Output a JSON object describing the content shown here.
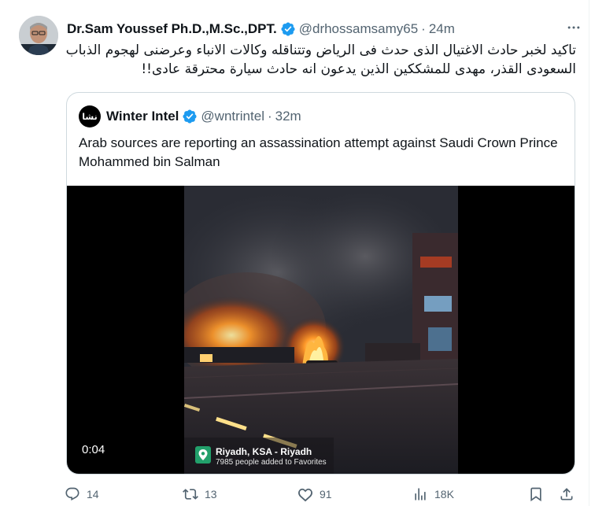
{
  "tweet": {
    "author_name": "Dr.Sam Youssef Ph.D.,M.Sc.,DPT.",
    "handle": "@drhossamsamy65",
    "separator": "·",
    "time": "24m",
    "text": "تاكيد لخبر حادث الاغتيال الذى حدث فى الرياض وتتناقله وكالات الانباء وعرضنى لهجوم الذباب السعودى القذر، مهدى للمشككين الذين يدعون انه حادث سيارة محترقة عادى!!"
  },
  "quote": {
    "avatar_text": "نشا",
    "author_name": "Winter Intel",
    "handle": "@wntrintel",
    "separator": "·",
    "time": "32m",
    "text": "Arab sources are reporting an assassination attempt against Saudi Crown Prince Mohammed bin Salman",
    "video": {
      "duration": "0:04",
      "location_title": "Riyadh, KSA - Riyadh",
      "location_subtitle": "7985 people added to Favorites"
    }
  },
  "actions": {
    "reply_count": "14",
    "retweet_count": "13",
    "like_count": "91",
    "views_count": "18K"
  },
  "colors": {
    "verified": "#1d9bf0",
    "muted": "#536471",
    "text": "#0f1419",
    "border": "#cfd9de"
  },
  "icons": [
    "verified-badge-icon",
    "more-icon",
    "location-pin-icon",
    "reply-icon",
    "retweet-icon",
    "like-icon",
    "views-icon",
    "bookmark-icon",
    "share-icon"
  ]
}
